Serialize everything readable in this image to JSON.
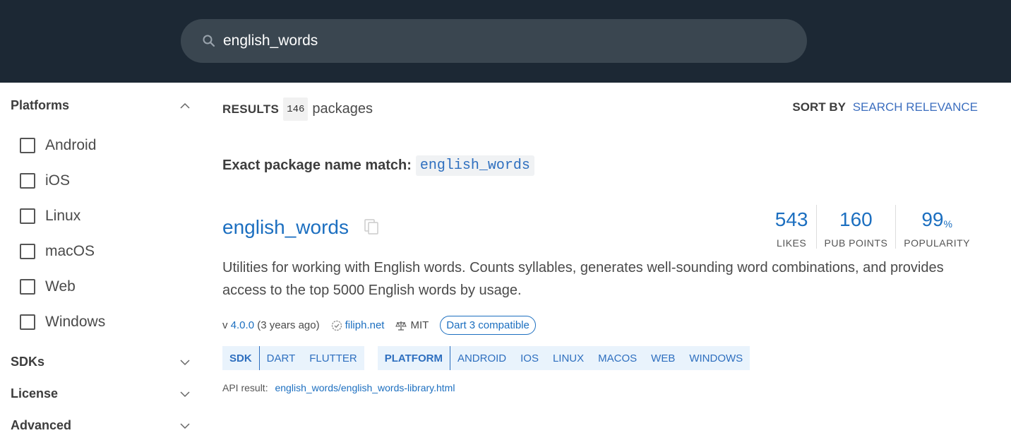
{
  "search": {
    "value": "english_words",
    "icon": "search-icon"
  },
  "sidebar": {
    "platforms_title": "Platforms",
    "platforms": [
      "Android",
      "iOS",
      "Linux",
      "macOS",
      "Web",
      "Windows"
    ],
    "sections": [
      "SDKs",
      "License",
      "Advanced"
    ]
  },
  "results": {
    "label": "RESULTS",
    "count": "146",
    "suffix": "packages"
  },
  "sort": {
    "label": "SORT BY",
    "value": "SEARCH RELEVANCE"
  },
  "exact": {
    "label": "Exact package name match:",
    "name": "english_words"
  },
  "package": {
    "name": "english_words",
    "likes": "543",
    "likes_label": "LIKES",
    "points": "160",
    "points_label": "PUB POINTS",
    "popularity": "99",
    "popularity_unit": "%",
    "popularity_label": "POPULARITY",
    "description": "Utilities for working with English words. Counts syllables, generates well-sounding word combinations, and provides access to the top 5000 English words by usage.",
    "version_prefix": "v",
    "version": "4.0.0",
    "age": "(3 years ago)",
    "publisher": "filiph.net",
    "license": "MIT",
    "dart3": "Dart 3 compatible",
    "sdk_head": "SDK",
    "sdk_tags": [
      "DART",
      "FLUTTER"
    ],
    "platform_head": "PLATFORM",
    "platform_tags": [
      "ANDROID",
      "IOS",
      "LINUX",
      "MACOS",
      "WEB",
      "WINDOWS"
    ],
    "api_label": "API result:",
    "api_link": "english_words/english_words-library.html"
  },
  "colors": {
    "header_bg": "#1c2834",
    "link": "#1c6fc0",
    "tag_bg": "#e9f3fc"
  }
}
